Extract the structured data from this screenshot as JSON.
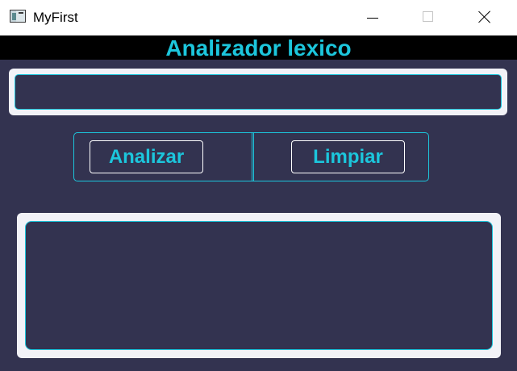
{
  "window": {
    "title": "MyFirst",
    "icon": "app-icon",
    "controls": {
      "minimize_icon": "minimize-icon",
      "maximize_icon": "maximize-icon",
      "close_icon": "close-icon"
    }
  },
  "header": {
    "title": "Analizador lexico"
  },
  "input": {
    "value": "",
    "placeholder": ""
  },
  "buttons": {
    "analyze_label": "Analizar",
    "clear_label": "Limpiar"
  },
  "output": {
    "value": ""
  },
  "colors": {
    "background": "#333350",
    "accent": "#1cc6dc",
    "header_background": "#000000",
    "field_frame": "#f2f2f7"
  }
}
